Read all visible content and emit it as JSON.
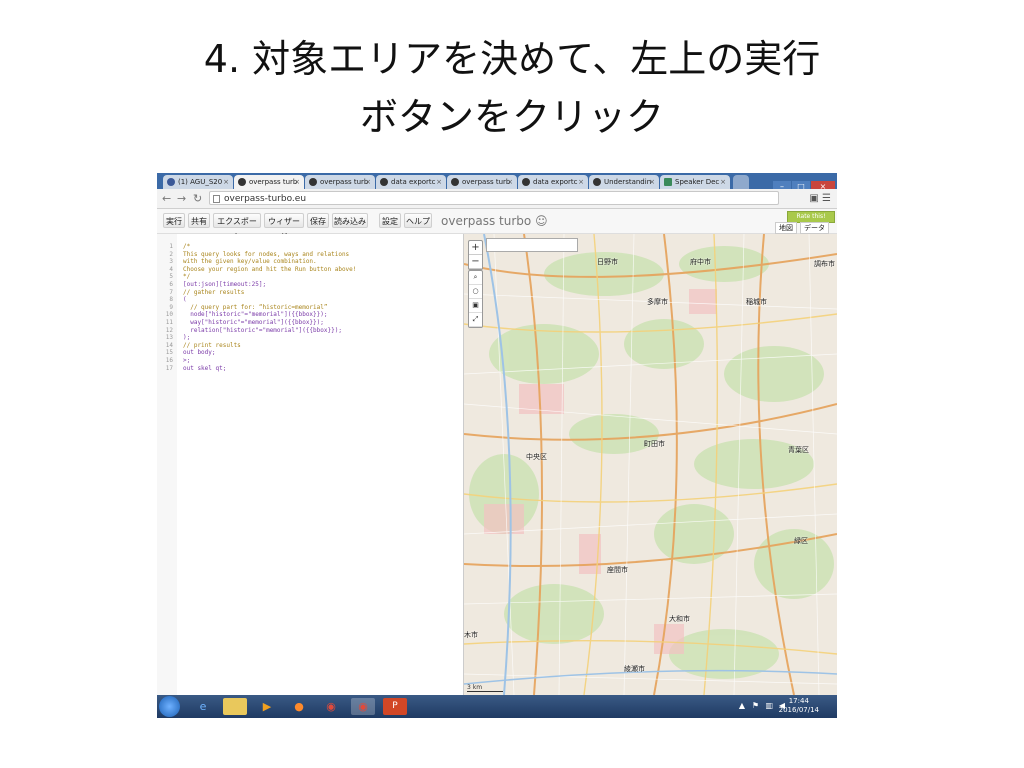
{
  "slide": {
    "title_line1": "4. 対象エリアを決めて、左上の実行",
    "title_line2": "ボタンをクリック"
  },
  "browser": {
    "tabs": [
      {
        "label": "(1) AGU_S20",
        "icon": "facebook-icon",
        "active": false
      },
      {
        "label": "overpass turb",
        "icon": "overpass-icon",
        "active": true
      },
      {
        "label": "overpass turb",
        "icon": "overpass-icon",
        "active": false
      },
      {
        "label": "data exportc",
        "icon": "github-icon",
        "active": false
      },
      {
        "label": "overpass turb",
        "icon": "overpass-icon",
        "active": false
      },
      {
        "label": "data exportc",
        "icon": "github-icon",
        "active": false
      },
      {
        "label": "Understandin",
        "icon": "github-icon",
        "active": false
      },
      {
        "label": "Speaker Dec",
        "icon": "speakerdeck-icon",
        "active": false
      }
    ],
    "url": "overpass-turbo.eu"
  },
  "toolbar": {
    "run": "実行",
    "share": "共有",
    "export": "エクスポート",
    "wizard": "ウィザード",
    "save": "保存",
    "load": "読み込み",
    "settings": "設定",
    "help": "ヘルプ",
    "brand": "overpass turbo ☺",
    "rate": "Rate this!",
    "map_tab": "地図",
    "data_tab": "データ"
  },
  "editor": {
    "line_numbers": [
      "1",
      "2",
      "3",
      "4",
      "5",
      "6",
      "7",
      "8",
      "9",
      "10",
      "11",
      "12",
      "13",
      "14",
      "15",
      "16",
      "17"
    ],
    "lines": [
      "/*",
      "This query looks for nodes, ways and relations",
      "with the given key/value combination.",
      "Choose your region and hit the Run button above!",
      "*/",
      "[out:json][timeout:25];",
      "// gather results",
      "(",
      "  // query part for: “historic=memorial”",
      "  node[\"historic\"=\"memorial\"]({{bbox}});",
      "  way[\"historic\"=\"memorial\"]({{bbox}});",
      "  relation[\"historic\"=\"memorial\"]({{bbox}});",
      ");",
      "// print results",
      "out body;",
      ">;",
      "out skel qt;"
    ]
  },
  "map": {
    "places": [
      "日野市",
      "府中市",
      "調布市",
      "多摩市",
      "稲城市",
      "町田市",
      "中央区",
      "大和市",
      "座間市",
      "綾瀬市",
      "青葉区",
      "緑区",
      "木市"
    ],
    "scale": "3 km"
  },
  "taskbar": {
    "time": "17:44",
    "date": "2016/07/14"
  }
}
